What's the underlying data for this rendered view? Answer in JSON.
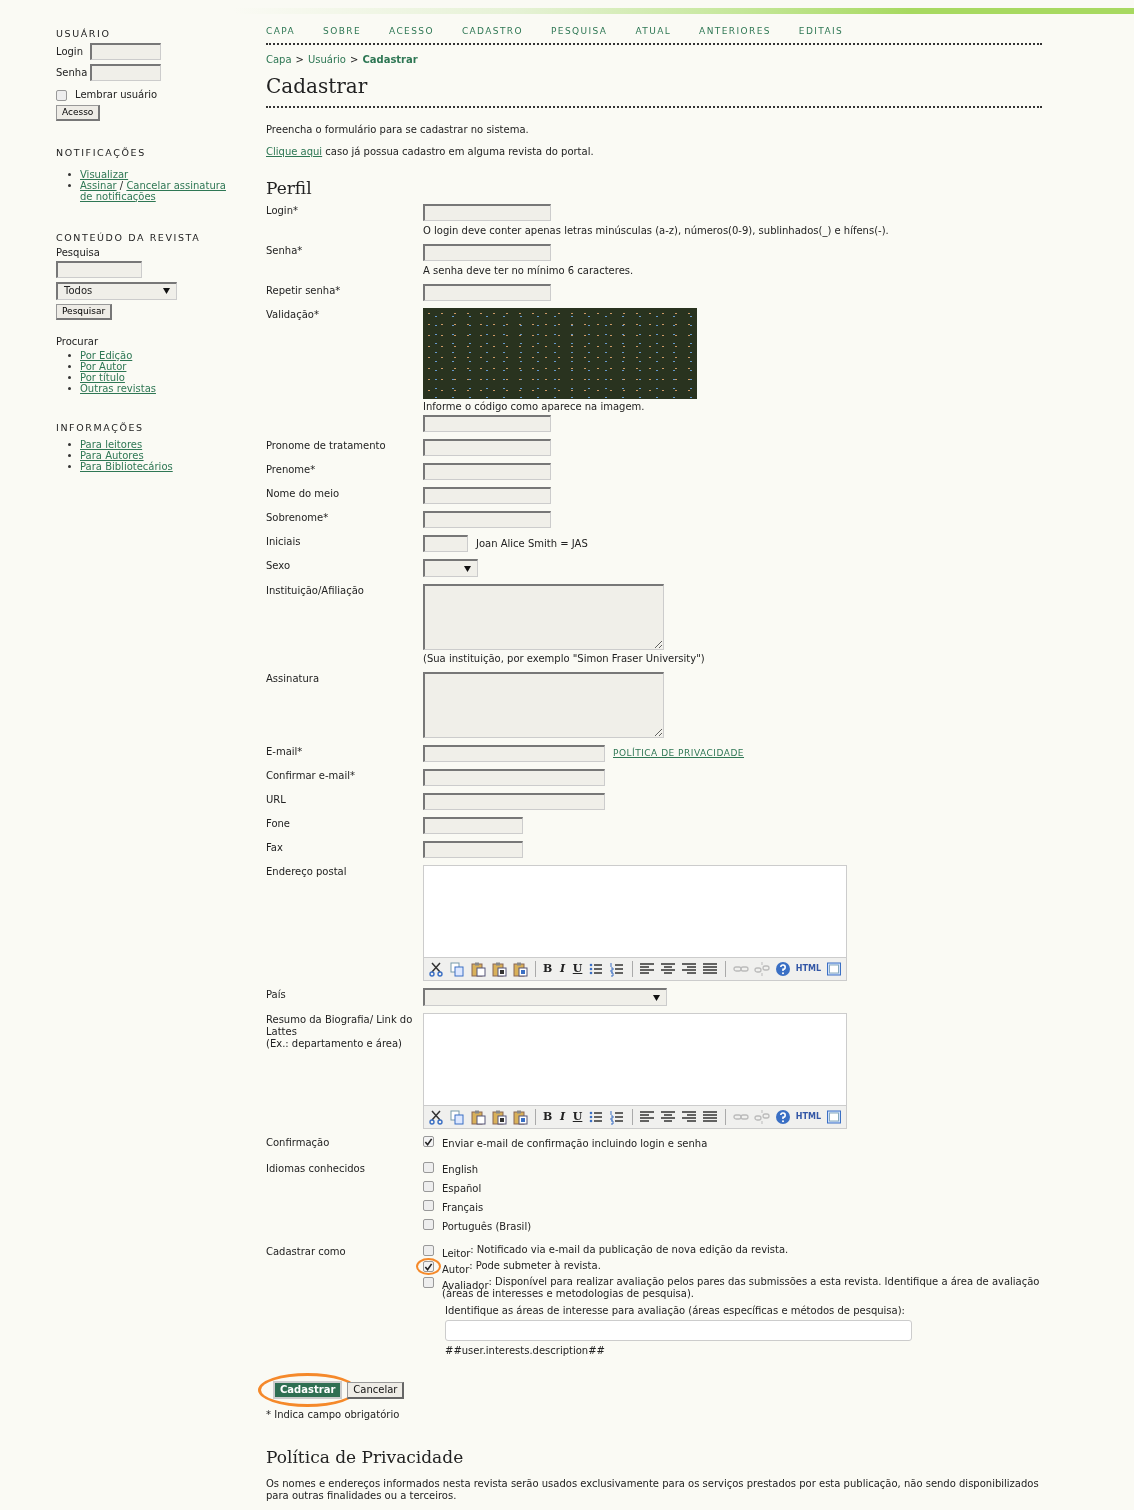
{
  "sidebar": {
    "user": {
      "title": "USUÁRIO",
      "fields": [
        {
          "label": "Login"
        },
        {
          "label": "Senha"
        }
      ],
      "remember": {
        "label": "Lembrar usuário",
        "checked": false
      },
      "button": "Acesso"
    },
    "notifications": {
      "title": "NOTIFICAÇÕES",
      "items": [
        {
          "lines": [
            [
              "Visualizar"
            ]
          ]
        },
        {
          "lines": [
            [
              "Assinar",
              "Cancelar assinatura"
            ],
            [
              "de notificações"
            ]
          ],
          "separator": "/"
        }
      ]
    },
    "journal_content": {
      "title": "CONTEÚDO DA REVISTA",
      "search_label": "Pesquisa",
      "scope": "Todos",
      "button": "Pesquisar",
      "browse_label": "Procurar",
      "links": [
        "Por Edição",
        "Por Autor",
        "Por título",
        "Outras revistas"
      ]
    },
    "information": {
      "title": "INFORMAÇÕES",
      "links": [
        "Para leitores",
        "Para Autores",
        "Para Bibliotecários"
      ]
    }
  },
  "nav": [
    "CAPA",
    "SOBRE",
    "ACESSO",
    "CADASTRO",
    "PESQUISA",
    "ATUAL",
    "ANTERIORES",
    "EDITAIS"
  ],
  "breadcrumb": [
    {
      "label": "Capa",
      "current": false,
      "separator": ">"
    },
    {
      "label": "Usuário",
      "current": false,
      "separator": ">"
    },
    {
      "label": "Cadastrar",
      "current": true
    }
  ],
  "title": "Cadastrar",
  "intro": "Preencha o formulário para se cadastrar no sistema.",
  "login_hint": {
    "link": "Clique aqui",
    "text": "caso já possua cadastro em alguma revista do portal."
  },
  "section": "Perfil",
  "rows": [
    {
      "label": "Login*",
      "kind": "input",
      "hint": "O login deve conter apenas letras minúsculas (a-z), números(0-9), sublinhados(_) e hífens(-)."
    },
    {
      "label": "Senha*",
      "kind": "input",
      "hint": "A senha deve ter no mínimo 6 caracteres."
    },
    {
      "label": "Repetir senha*",
      "kind": "input"
    },
    {
      "label": "Validação*",
      "kind": "captcha",
      "hint": "Informe o código como aparece na imagem."
    },
    {
      "label": "Pronome de tratamento",
      "kind": "input"
    },
    {
      "label": "Prenome*",
      "kind": "input"
    },
    {
      "label": "Nome do meio",
      "kind": "input"
    },
    {
      "label": "Sobrenome*",
      "kind": "input"
    },
    {
      "label": "Iniciais",
      "kind": "tiny_input",
      "note": "Joan Alice Smith = JAS"
    },
    {
      "label": "Sexo",
      "kind": "select"
    },
    {
      "label": "Instituição/Afiliação",
      "kind": "textarea",
      "hint": "(Sua instituição, por exemplo \"Simon Fraser University\")"
    },
    {
      "label": "Assinatura",
      "kind": "textarea"
    },
    {
      "label": "E-mail*",
      "kind": "wide_input",
      "link": "POLÍTICA DE PRIVACIDADE"
    },
    {
      "label": "Confirmar e-mail*",
      "kind": "wide_input"
    },
    {
      "label": "URL",
      "kind": "wide_input"
    },
    {
      "label": "Fone",
      "kind": "short_input"
    },
    {
      "label": "Fax",
      "kind": "short_input"
    },
    {
      "label": "Endereço postal",
      "kind": "editor",
      "toolbar": [
        {
          "kind": "cut"
        },
        {
          "kind": "copy"
        },
        {
          "kind": "paste"
        },
        {
          "kind": "paste-text"
        },
        {
          "kind": "paste-word"
        },
        {
          "kind": "sep"
        },
        {
          "kind": "bold",
          "text": "B"
        },
        {
          "kind": "italic",
          "text": "I"
        },
        {
          "kind": "underline",
          "text": "U"
        },
        {
          "kind": "bullets"
        },
        {
          "kind": "numbers"
        },
        {
          "kind": "sep"
        },
        {
          "kind": "left"
        },
        {
          "kind": "center"
        },
        {
          "kind": "right"
        },
        {
          "kind": "justify"
        },
        {
          "kind": "sep"
        },
        {
          "kind": "link",
          "disabled": true
        },
        {
          "kind": "unlink",
          "disabled": true
        },
        {
          "kind": "help"
        },
        {
          "kind": "html",
          "text": "HTML"
        },
        {
          "kind": "fullscreen"
        }
      ]
    },
    {
      "label": "País",
      "kind": "wide_select"
    },
    {
      "label": "Resumo da Biografia/ Link do Lattes\n(Ex.: departamento e área)",
      "kind": "editor",
      "toolbar": [
        {
          "kind": "cut"
        },
        {
          "kind": "copy"
        },
        {
          "kind": "paste"
        },
        {
          "kind": "paste-text"
        },
        {
          "kind": "paste-word"
        },
        {
          "kind": "sep"
        },
        {
          "kind": "bold",
          "text": "B"
        },
        {
          "kind": "italic",
          "text": "I"
        },
        {
          "kind": "underline",
          "text": "U"
        },
        {
          "kind": "bullets"
        },
        {
          "kind": "numbers"
        },
        {
          "kind": "sep"
        },
        {
          "kind": "left"
        },
        {
          "kind": "center"
        },
        {
          "kind": "right"
        },
        {
          "kind": "justify"
        },
        {
          "kind": "sep"
        },
        {
          "kind": "link",
          "disabled": true
        },
        {
          "kind": "unlink",
          "disabled": true
        },
        {
          "kind": "help"
        },
        {
          "kind": "html",
          "text": "HTML"
        },
        {
          "kind": "fullscreen"
        }
      ]
    },
    {
      "label": "Confirmação",
      "kind": "checks",
      "options": [
        {
          "label": "Enviar e-mail de confirmação incluindo login e senha",
          "checked": true
        }
      ]
    },
    {
      "label": "Idiomas conhecidos",
      "kind": "checks",
      "options": [
        {
          "label": "English",
          "checked": false
        },
        {
          "label": "Español",
          "checked": false
        },
        {
          "label": "Français",
          "checked": false
        },
        {
          "label": "Português (Brasil)",
          "checked": false
        }
      ]
    },
    {
      "label": "Cadastrar como",
      "kind": "roles",
      "options": [
        {
          "label": "Leitor",
          "description": ": Notificado via e-mail da publicação de nova edição da revista.",
          "checked": false,
          "highlighted": false
        },
        {
          "label": "Autor",
          "description": ": Pode submeter à revista.",
          "checked": true,
          "highlighted": true
        },
        {
          "label": "Avaliador",
          "description": ": Disponível para realizar avaliação pelos pares das submissões a esta revista. Identifique a área de avaliação (áreas de interesses e metodologias de pesquisa).",
          "checked": false,
          "highlighted": false,
          "interests": {
            "prompt": "Identifique as áreas de interesse para avaliação (áreas específicas e métodos de pesquisa):",
            "note": "##user.interests.description##"
          }
        }
      ]
    }
  ],
  "buttons": [
    {
      "label": "Cadastrar",
      "kind": "primary",
      "highlighted": true
    },
    {
      "label": "Cancelar",
      "kind": "secondary",
      "highlighted": false
    }
  ],
  "required_note": "* Indica campo obrigatório",
  "privacy": {
    "title": "Política de Privacidade",
    "text": "Os nomes e endereços informados nesta revista serão usados exclusivamente para os serviços prestados por esta publicação, não sendo disponibilizados para outras finalidades ou a terceiros."
  }
}
